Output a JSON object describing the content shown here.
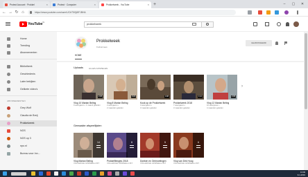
{
  "browser": {
    "tabs": [
      {
        "label": "Protect Account · Prokkel"
      },
      {
        "label": "Protect · Computer"
      },
      {
        "label": "Prokkelweek - YouTube"
      }
    ],
    "newtab": "+",
    "window": {
      "min": "–",
      "max": "▢",
      "close": "✕"
    },
    "nav": {
      "back": "←",
      "forward": "→",
      "reload": "↻",
      "home": "⌂"
    },
    "url": "https://www.youtube.com/user/UCbT5Gj8lFJBHA"
  },
  "youtube": {
    "logo_text": "YouTube",
    "logo_region": "NL",
    "search_value": "prokkelweek"
  },
  "sidebar": {
    "top": [
      {
        "label": "Home",
        "icon": "home-icon"
      },
      {
        "label": "Trending",
        "icon": "flame-icon"
      },
      {
        "label": "Abonnementen",
        "icon": "subscriptions-icon"
      }
    ],
    "library": [
      {
        "label": "Bibliotheek",
        "icon": "library-icon"
      },
      {
        "label": "Geschiedenis",
        "icon": "history-icon"
      },
      {
        "label": "Later bekijken",
        "icon": "clock-icon"
      },
      {
        "label": "Gelikete video's",
        "icon": "thumbs-up-icon"
      }
    ],
    "subs_heading": "ABONNEMENTEN",
    "subs": [
      {
        "label": "Grey Wolf",
        "badge": "",
        "color": "#c0392b"
      },
      {
        "label": "Claudia de Breij",
        "badge": "",
        "color": "#c9a27a"
      },
      {
        "label": "Prokkelweek",
        "badge": "",
        "color": "#e8a0c8"
      },
      {
        "label": "NOS",
        "badge": "",
        "color": "#e74c3c"
      },
      {
        "label": "NOS op 3",
        "badge": "",
        "color": "#d35400"
      },
      {
        "label": "npo.nl",
        "badge": "",
        "color": "#7f8c8d"
      },
      {
        "label": "Bureau voor Inn...",
        "badge": "",
        "color": "#95a5a6"
      }
    ]
  },
  "channel": {
    "name": "Prokkelweek",
    "subs": "9 abonnees",
    "subscribed_label": "GEABONNEERD",
    "tab": "HOME"
  },
  "uploads": {
    "title": "Uploads",
    "playall": "ALLES AFSPELEN",
    "videos": [
      {
        "title": "Vlog 10 Marian Beling",
        "meta1": "9 weergaven • 1 maand geleden",
        "meta2": "",
        "duration": "2:38",
        "bg": "#8a7f70",
        "face": "#c8a58c"
      },
      {
        "title": "Vlog 8 Marian Beling",
        "meta1": "2 weergaven •",
        "meta2": "2 maanden geleden",
        "duration": "3:24",
        "bg": "#d9c8b5",
        "face": "#d4b090"
      },
      {
        "title": "Kook op de Prokkelweek",
        "meta1": "3 weergaven •",
        "meta2": "3 maanden geleden",
        "duration": "4:08",
        "bg": "#7a6a58",
        "face": "#4a3a2a"
      },
      {
        "title": "Prokkelweek 2018",
        "meta1": "7 weergaven •",
        "meta2": "3 maanden geleden",
        "duration": "1:12",
        "bg": "#5c4e3e",
        "face": "#b08e6e"
      },
      {
        "title": "Vlog 12 Marian Beling",
        "meta1": "10 weergaven •",
        "meta2": "4 maanden geleden",
        "duration": "2:08",
        "bg": "#b8c4c8",
        "face": "#d4a88a"
      }
    ]
  },
  "playlists": {
    "title": "Gemaakte afspeellijsten",
    "items": [
      {
        "title": "Vlog Marian Beling",
        "meta": "VOLLEDIGE AFSPEELLIJST",
        "count": "14",
        "bg": "#9c8b7a"
      },
      {
        "title": "Prokkelfilmpjes 2018",
        "meta": "VOLLEDIGE AFSPEELLIJST",
        "count": "8",
        "bg": "#5a4a8a"
      },
      {
        "title": "Doeken en Ontmoetingen",
        "meta": "VOLLEDIGE AFSPEELLIJST",
        "count": "5",
        "bg": "#a33a2a"
      },
      {
        "title": "Vlog van Dirk Hoog",
        "meta": "VOLLEDIGE AFSPEELLIJST",
        "count": "6",
        "bg": "#8a3a1f"
      }
    ]
  },
  "taskbar": {
    "time": "13:00",
    "date": "9-1-2019"
  }
}
